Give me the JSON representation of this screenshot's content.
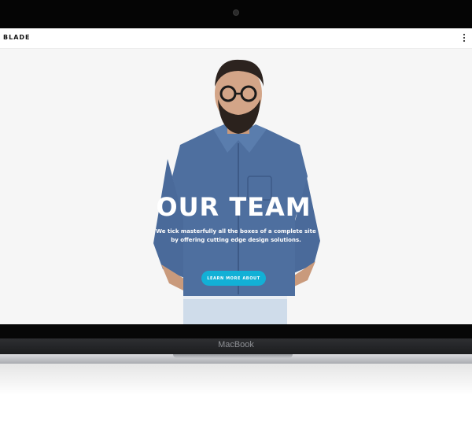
{
  "site": {
    "logo": "BLADE",
    "menu_icon": "vertical-dots-icon"
  },
  "hero": {
    "title": "OUR TEAM",
    "subtitle_line1": "We tick masterfully all the boxes of a complete site",
    "subtitle_line2": "by offering cutting edge design solutions.",
    "cta_label": "LEARN MORE ABOUT"
  },
  "device": {
    "brand": "MacBook"
  },
  "colors": {
    "accent": "#12b0d6",
    "shirt": "#4a6a9a",
    "screen_bg": "#f6f6f6"
  }
}
